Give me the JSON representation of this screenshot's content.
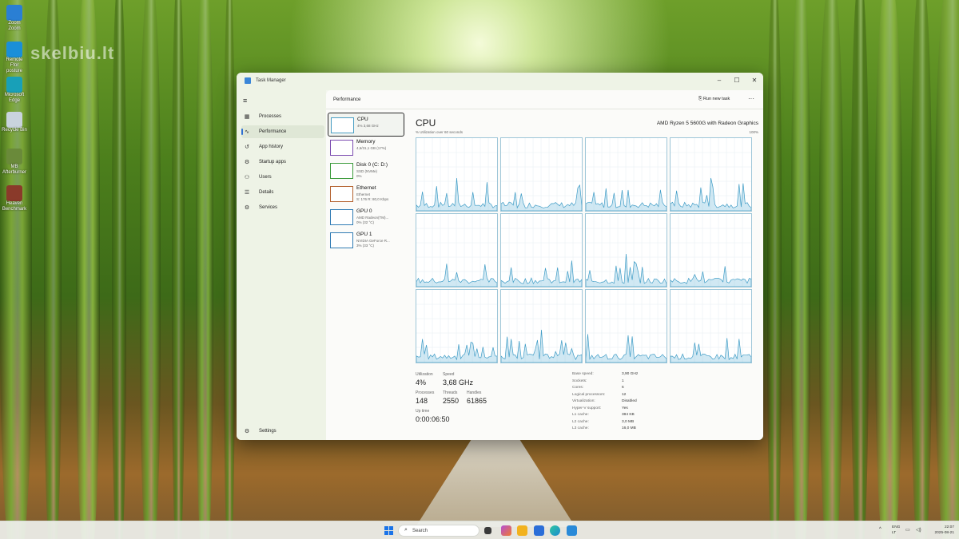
{
  "watermark": "skelbiu.lt",
  "desktop_icons": [
    {
      "label": "Zoom Zoom",
      "color": "#2a7fd4",
      "icon": "folder-icon"
    },
    {
      "label": "Remote Ffor posture",
      "color": "#1a8fd8",
      "icon": "app-icon"
    },
    {
      "label": "Microsoft Edge",
      "color": "#18a0b8",
      "icon": "edge-icon"
    },
    {
      "label": "Recycle Bin",
      "color": "#c9d3dd",
      "icon": "recycle-bin-icon"
    },
    {
      "label": "MB Afterburner",
      "color": "#6a8a3a",
      "icon": "afterburner-icon"
    },
    {
      "label": "Heaven Benchmark",
      "color": "#8a3a2a",
      "icon": "benchmark-icon"
    }
  ],
  "window": {
    "title": "Task Manager",
    "minimize": "–",
    "maximize": "☐",
    "close": "✕"
  },
  "nav": {
    "items": [
      {
        "label": "Processes",
        "icon": "▦"
      },
      {
        "label": "Performance",
        "icon": "∿"
      },
      {
        "label": "App history",
        "icon": "↺"
      },
      {
        "label": "Startup apps",
        "icon": "⚙"
      },
      {
        "label": "Users",
        "icon": "⚇"
      },
      {
        "label": "Details",
        "icon": "☰"
      },
      {
        "label": "Services",
        "icon": "⚙"
      }
    ],
    "settings": {
      "label": "Settings",
      "icon": "⚙"
    }
  },
  "header": {
    "title": "Performance",
    "run_task": "Run new task",
    "more": "···"
  },
  "resources": [
    {
      "name": "CPU",
      "sub1": "4% 3,68 GHz",
      "sub2": ""
    },
    {
      "name": "Memory",
      "sub1": "4,6/31,1 GB (17%)",
      "sub2": ""
    },
    {
      "name": "Disk 0 (C: D:)",
      "sub1": "SSD (NVMe)",
      "sub2": "0%"
    },
    {
      "name": "Ethernet",
      "sub1": "Ethernet",
      "sub2": "S: 176 R: 80,0 Kbps"
    },
    {
      "name": "GPU 0",
      "sub1": "AMD Radeon(TM)...",
      "sub2": "0% (32 °C)"
    },
    {
      "name": "GPU 1",
      "sub1": "NVIDIA GeForce R...",
      "sub2": "3% (33 °C)"
    }
  ],
  "cpu": {
    "title": "CPU",
    "model": "AMD Ryzen 5 5600G with Radeon Graphics",
    "caption": "% Utilization over 60 seconds",
    "max": "100%",
    "stats": {
      "utilization_label": "Utilization",
      "utilization": "4%",
      "speed_label": "Speed",
      "speed": "3,68 GHz",
      "processes_label": "Processes",
      "processes": "148",
      "threads_label": "Threads",
      "threads": "2550",
      "handles_label": "Handles",
      "handles": "61865",
      "uptime_label": "Up time",
      "uptime": "0:00:06:50"
    },
    "specs": [
      {
        "k": "Base speed:",
        "v": "3,90 GHz"
      },
      {
        "k": "Sockets:",
        "v": "1"
      },
      {
        "k": "Cores:",
        "v": "6"
      },
      {
        "k": "Logical processors:",
        "v": "12"
      },
      {
        "k": "Virtualization:",
        "v": "Disabled"
      },
      {
        "k": "Hyper-V support:",
        "v": "Yes"
      },
      {
        "k": "L1 cache:",
        "v": "384 KB"
      },
      {
        "k": "L2 cache:",
        "v": "3,0 MB"
      },
      {
        "k": "L3 cache:",
        "v": "16,0 MB"
      }
    ]
  },
  "taskbar": {
    "search_placeholder": "Search",
    "lang": "ENG",
    "lang2": "LT",
    "time": "22:07",
    "date": "2025-08-21",
    "colors": {
      "files": "#f2b21e",
      "edge": "#1b8bd0",
      "store": "#2b6ed8",
      "copilot": "#b44fd6",
      "explorer": "#2a6fc9",
      "taskmgr": "#2a8ad8"
    }
  }
}
